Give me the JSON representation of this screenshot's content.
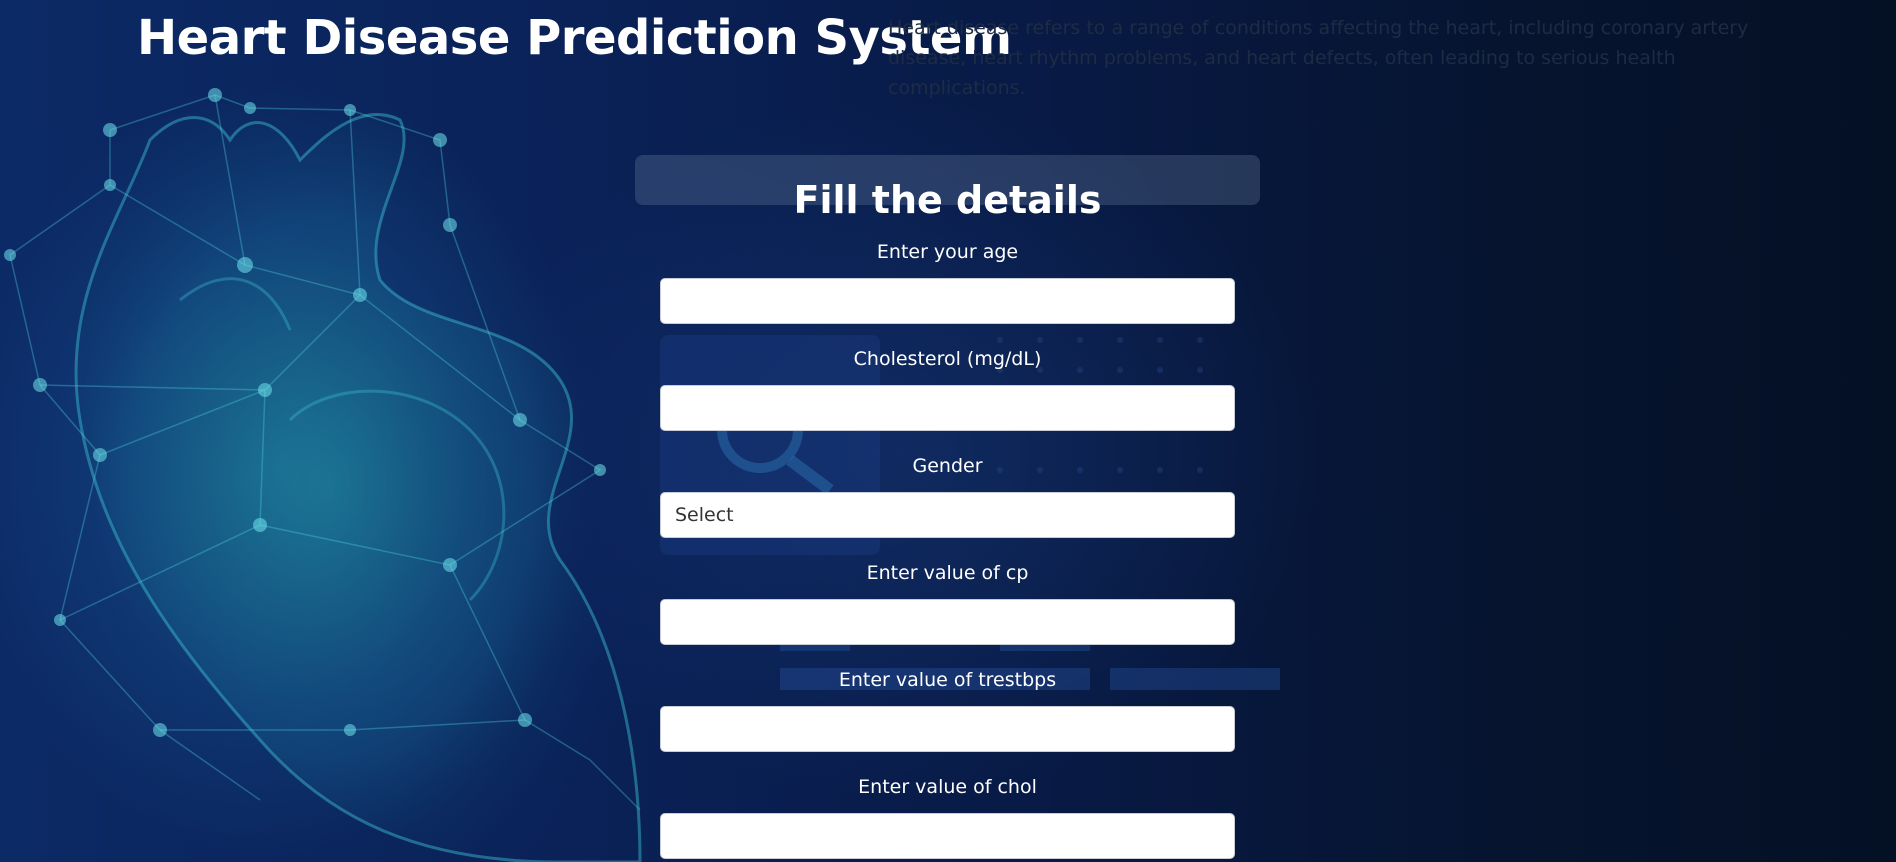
{
  "header": {
    "title": "Heart Disease Prediction System",
    "description": "Heart disease refers to a range of conditions affecting the heart, including coronary artery disease, heart rhythm problems, and heart defects, often leading to serious health complications."
  },
  "form": {
    "title": "Fill the details",
    "fields": [
      {
        "label": "Enter your age",
        "value": "",
        "type": "input"
      },
      {
        "label": "Cholesterol (mg/dL)",
        "value": "",
        "type": "input"
      },
      {
        "label": "Gender",
        "value": "Select",
        "type": "select"
      },
      {
        "label": "Enter value of cp",
        "value": "",
        "type": "input"
      },
      {
        "label": "Enter value of trestbps",
        "value": "",
        "type": "input"
      },
      {
        "label": "Enter value of chol",
        "value": "",
        "type": "input"
      }
    ]
  },
  "background": {
    "image": "heart-network-illustration",
    "colors": {
      "dark_navy": "#041024",
      "navy": "#0a2258",
      "teal_glow": "#2496aa"
    }
  }
}
